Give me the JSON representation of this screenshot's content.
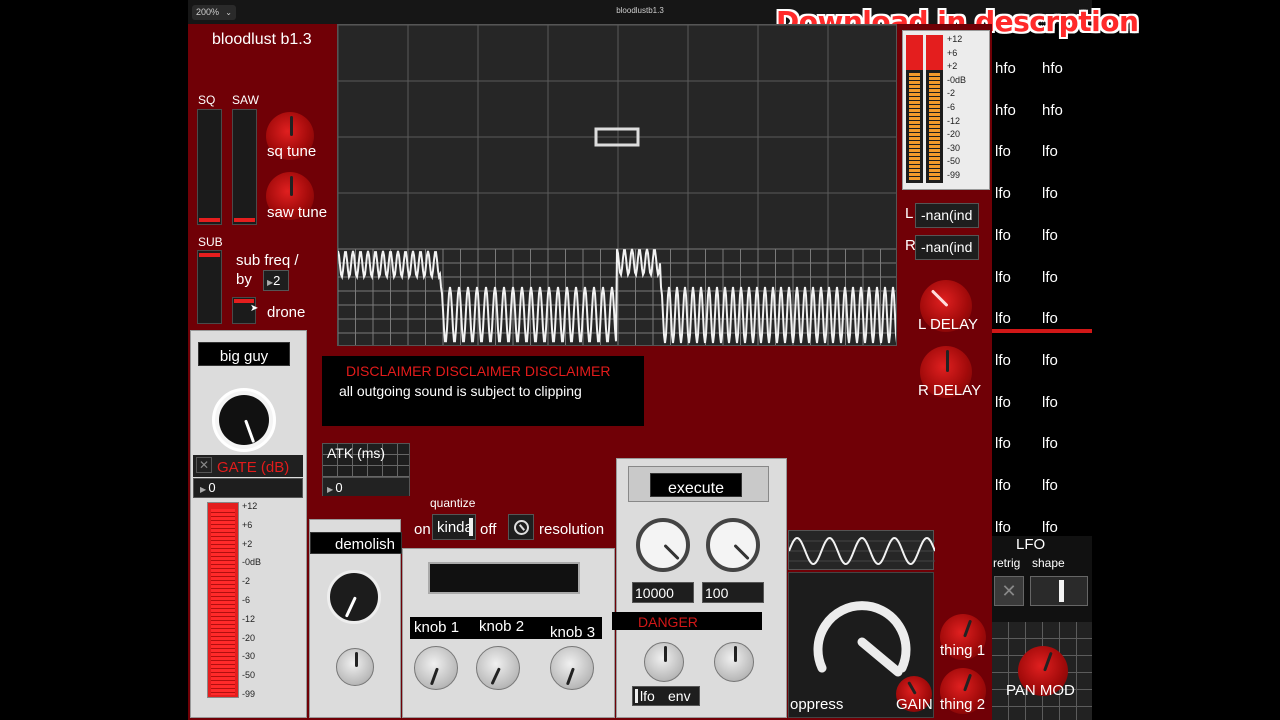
{
  "window": {
    "zoom": "200%",
    "title": "bloodlustb1.3",
    "promo": "Download in descrption"
  },
  "app": {
    "title": "bloodlust b1.3"
  },
  "osc": {
    "sq_label": "SQ",
    "saw_label": "SAW",
    "sub_label": "SUB",
    "sq_tune_label": "sq tune",
    "saw_tune_label": "saw tune",
    "sub_freq_label": "sub freq /",
    "by_label": "by",
    "by_value": "2",
    "drone_label": "drone"
  },
  "meter": {
    "ticks": [
      "+12",
      "+6",
      "+2",
      "-0dB",
      "-2",
      "-6",
      "-12",
      "-20",
      "-30",
      "-50",
      "-99"
    ],
    "l_label": "L",
    "r_label": "R",
    "l_value": "-nan(ind",
    "r_value": "-nan(ind"
  },
  "delay": {
    "l_label": "L DELAY",
    "r_label": "R DELAY"
  },
  "disclaimer": {
    "title": "DISCLAIMER DISCLAIMER DISCLAIMER",
    "body": "all outgoing sound is subject to clipping"
  },
  "bigguy": {
    "button": "big guy",
    "gate_label": "GATE (dB)",
    "gate_value": "0",
    "ticks": [
      "+12",
      "+6",
      "+2",
      "-0dB",
      "-2",
      "-6",
      "-12",
      "-20",
      "-30",
      "-50",
      "-99"
    ]
  },
  "atk": {
    "label": "ATK (ms)",
    "value": "0"
  },
  "quant": {
    "label": "quantize",
    "on": "on",
    "mode": "kinda",
    "off": "off",
    "resolution": "resolution"
  },
  "demolish": {
    "button": "demolish"
  },
  "knobs": {
    "k1": "knob 1",
    "k2": "knob 2",
    "k3": "knob 3"
  },
  "execute": {
    "button": "execute",
    "v1": "10000",
    "v2": "100",
    "danger": "DANGER",
    "lfo": "lfo",
    "env": "env"
  },
  "bottom": {
    "oppress": "oppress",
    "gain": "GAIN",
    "thing1": "thing 1",
    "thing2": "thing 2"
  },
  "lfo": {
    "rows": [
      [
        "hfo",
        "hfo"
      ],
      [
        "hfo",
        "hfo"
      ],
      [
        "lfo",
        "lfo"
      ],
      [
        "lfo",
        "lfo"
      ],
      [
        "lfo",
        "lfo"
      ],
      [
        "lfo",
        "lfo"
      ],
      [
        "lfo",
        "lfo"
      ],
      [
        "lfo",
        "lfo"
      ],
      [
        "lfo",
        "lfo"
      ],
      [
        "lfo",
        "lfo"
      ],
      [
        "lfo",
        "lfo"
      ],
      [
        "lfo",
        "lfo"
      ]
    ],
    "title": "LFO",
    "retrig": "retrig",
    "shape": "shape",
    "pan_mod": "PAN MOD"
  },
  "colors": {
    "panel_red": "#700006",
    "accent_red": "#e41e1e",
    "danger_red": "#d11717"
  }
}
